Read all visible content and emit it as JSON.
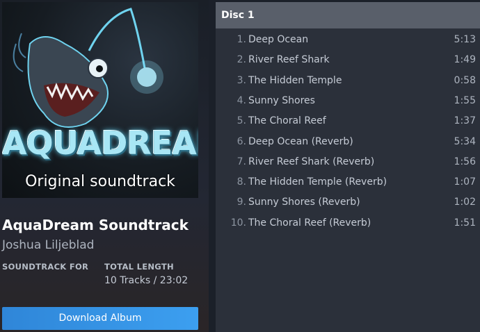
{
  "album": {
    "cover_title": "AQUADREAM",
    "cover_subtitle": "Original soundtrack",
    "title": "AquaDream Soundtrack",
    "artist": "Joshua Liljeblad",
    "soundtrack_for_label": "SOUNDTRACK FOR",
    "total_length_label": "TOTAL LENGTH",
    "total_length_value": "10 Tracks / 23:02",
    "download_label": "Download Album"
  },
  "disc": {
    "title": "Disc 1",
    "tracks": [
      {
        "num": "1.",
        "name": "Deep Ocean",
        "duration": "5:13"
      },
      {
        "num": "2.",
        "name": "River Reef Shark",
        "duration": "1:49"
      },
      {
        "num": "3.",
        "name": "The Hidden Temple",
        "duration": "0:58"
      },
      {
        "num": "4.",
        "name": "Sunny Shores",
        "duration": "1:55"
      },
      {
        "num": "5.",
        "name": "The Choral Reef",
        "duration": "1:37"
      },
      {
        "num": "6.",
        "name": "Deep Ocean (Reverb)",
        "duration": "5:34"
      },
      {
        "num": "7.",
        "name": "River Reef Shark (Reverb)",
        "duration": "1:56"
      },
      {
        "num": "8.",
        "name": "The Hidden Temple (Reverb)",
        "duration": "1:07"
      },
      {
        "num": "9.",
        "name": "Sunny Shores (Reverb)",
        "duration": "1:02"
      },
      {
        "num": "10.",
        "name": "The Choral Reef (Reverb)",
        "duration": "1:51"
      }
    ]
  },
  "colors": {
    "button": "#3c9ff0",
    "disc_header": "#595f6a",
    "panel": "#2b303a"
  }
}
